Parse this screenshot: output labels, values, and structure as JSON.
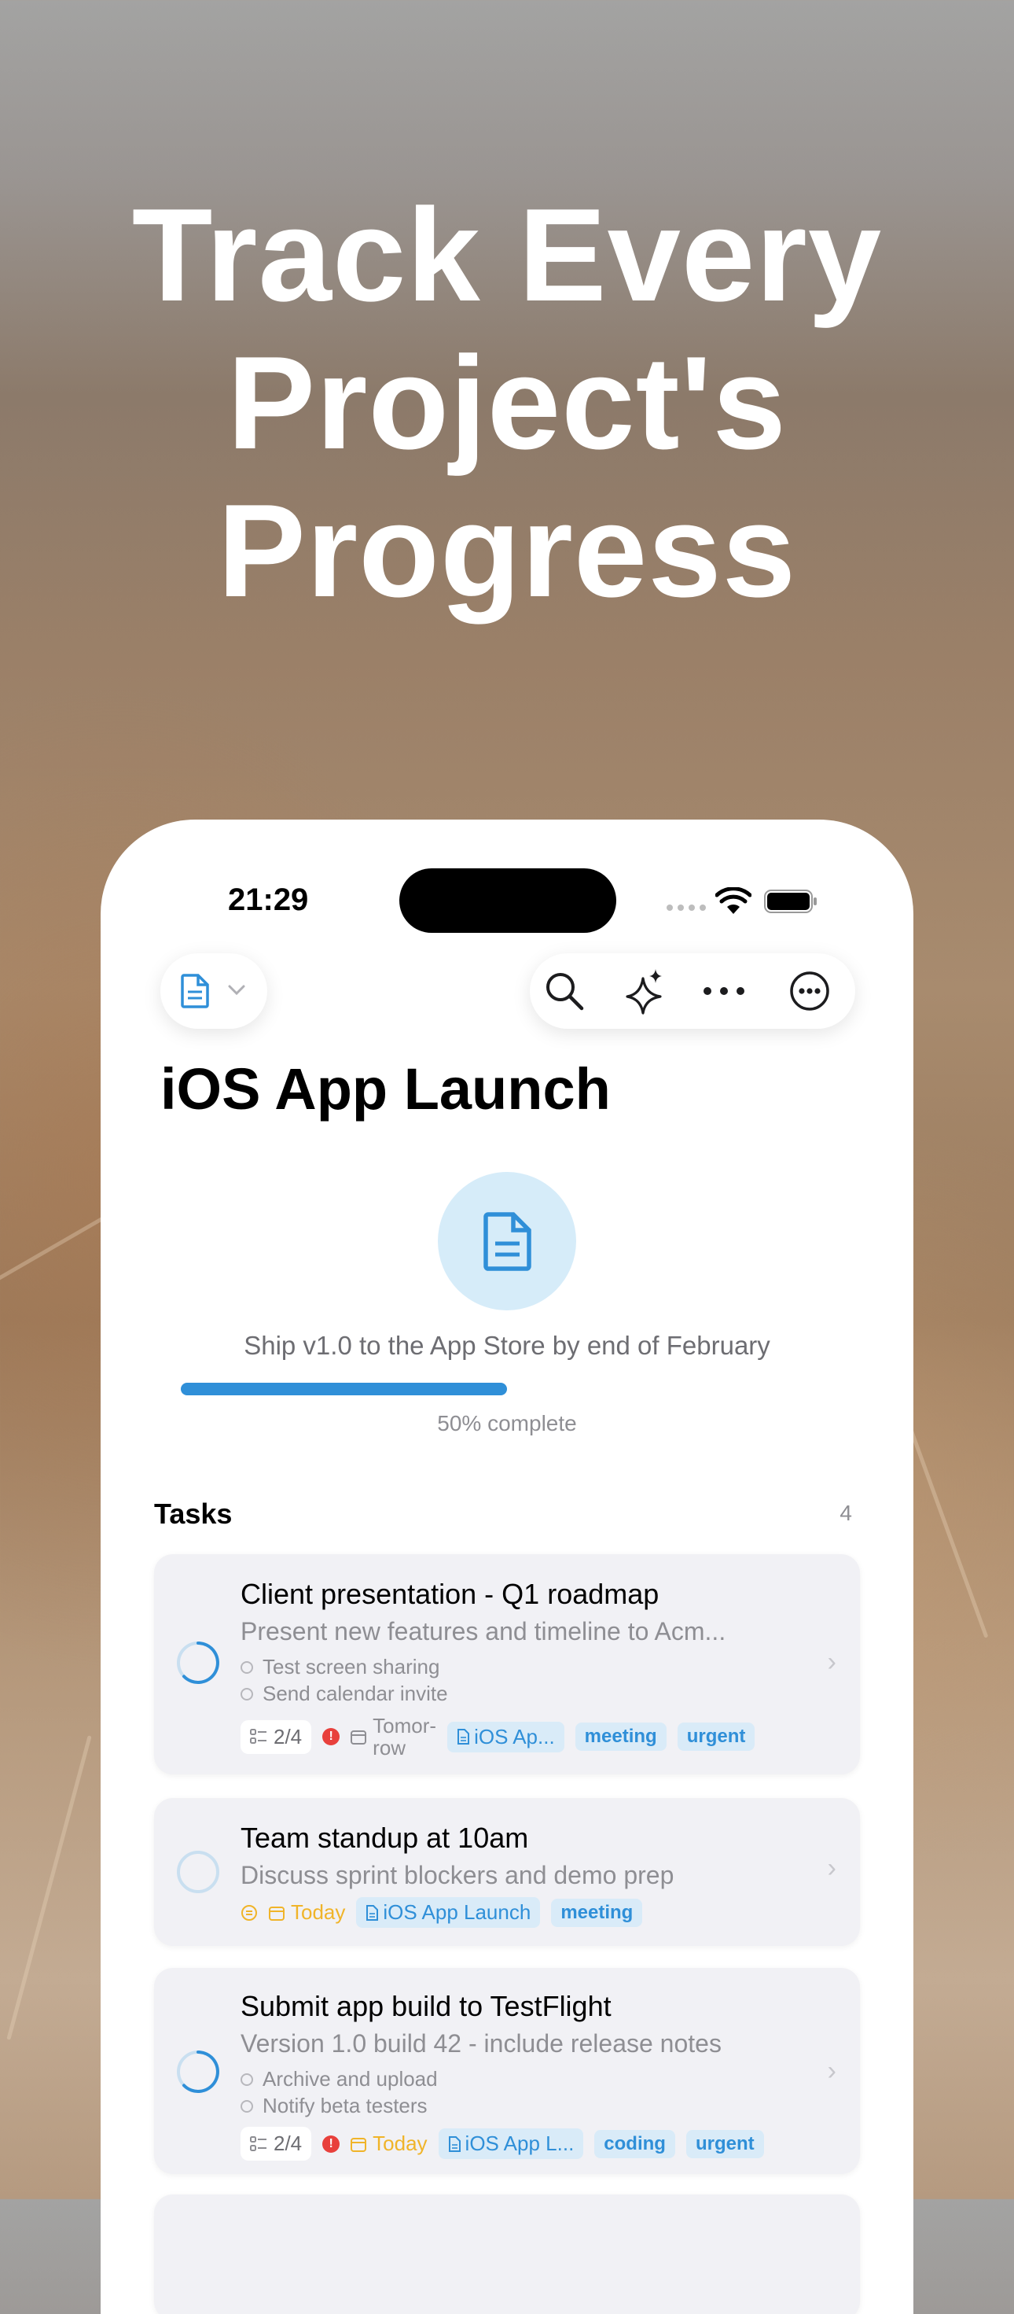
{
  "headline": [
    "Track Every",
    "Project's",
    "Progress"
  ],
  "status_bar": {
    "time": "21:29"
  },
  "toolbar": {
    "left_icon": "document-icon",
    "right_icons": [
      "search-icon",
      "sparkles-icon",
      "more-icon",
      "more-circle-icon"
    ]
  },
  "project": {
    "title": "iOS App Launch",
    "description": "Ship v1.0 to the App Store by end of February",
    "progress": 0.5,
    "progress_label": "50% complete",
    "accent_color": "#2f8fd8"
  },
  "tasks_section": {
    "heading": "Tasks",
    "count": "4"
  },
  "tasks": [
    {
      "title": "Client presentation - Q1 roadmap",
      "description": "Present new features and timeline to Acm...",
      "subtasks": [
        "Test screen sharing",
        "Send calendar invite"
      ],
      "checklist": "2/4",
      "due": "Tomor-\nrow",
      "project_tag": "iOS Ap...",
      "tags": [
        "meeting",
        "urgent"
      ]
    },
    {
      "title": "Team standup at 10am",
      "description": "Discuss sprint blockers and demo prep",
      "due": "Today",
      "project_tag": "iOS App Launch",
      "tags": [
        "meeting"
      ]
    },
    {
      "title": "Submit app build to TestFlight",
      "description": "Version 1.0 build 42 - include release notes",
      "subtasks": [
        "Archive and upload",
        "Notify beta testers"
      ],
      "checklist": "2/4",
      "due": "Today",
      "project_tag": "iOS App L...",
      "tags": [
        "coding",
        "urgent"
      ]
    }
  ]
}
